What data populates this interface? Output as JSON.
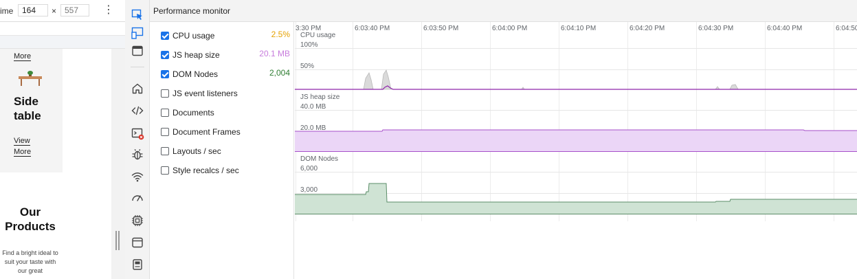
{
  "device_toolbar": {
    "label_partial": "ime",
    "width_value": "164",
    "times_sign": "×",
    "height_value": "557",
    "more_label": "⋮"
  },
  "page_preview": {
    "card_link_top": "More",
    "product_title": "Side table",
    "card_link_view": "View",
    "card_link_more": "More",
    "section_title": "Our Products",
    "section_desc": "Find a bright ideal to suit your taste with our great"
  },
  "panel": {
    "title": "Performance monitor"
  },
  "metrics": [
    {
      "label": "CPU usage",
      "checked": true,
      "value": "2.5%",
      "color": "#e5a100"
    },
    {
      "label": "JS heap size",
      "checked": true,
      "value": "20.1 MB",
      "color": "#c77cdc"
    },
    {
      "label": "DOM Nodes",
      "checked": true,
      "value": "2,004",
      "color": "#2e7d32"
    },
    {
      "label": "JS event listeners",
      "checked": false,
      "value": ""
    },
    {
      "label": "Documents",
      "checked": false,
      "value": ""
    },
    {
      "label": "Document Frames",
      "checked": false,
      "value": ""
    },
    {
      "label": "Layouts / sec",
      "checked": false,
      "value": ""
    },
    {
      "label": "Style recalcs / sec",
      "checked": false,
      "value": ""
    }
  ],
  "timeline": {
    "ticks": [
      "3:30 PM",
      "6:03:40 PM",
      "6:03:50 PM",
      "6:04:00 PM",
      "6:04:10 PM",
      "6:04:20 PM",
      "6:04:30 PM",
      "6:04:40 PM",
      "6:04:50"
    ]
  },
  "charts": {
    "cpu": {
      "name": "CPU usage",
      "gridlines": [
        "100%",
        "50%"
      ],
      "stroke": "#8e24aa",
      "fill": "#dadada"
    },
    "heap": {
      "name": "JS heap size",
      "gridlines": [
        "40.0 MB",
        "20.0 MB"
      ],
      "stroke": "#a64fc9",
      "fill": "#ebd6f7"
    },
    "dom": {
      "name": "DOM Nodes",
      "gridlines": [
        "6,000",
        "3,000"
      ],
      "stroke": "#5b8d68",
      "fill": "#cfe3d4"
    }
  },
  "icons": {
    "activity": [
      "inspect-icon",
      "device-toggle-icon",
      "window-icon",
      "home-icon",
      "code-icon",
      "console-icon",
      "bug-icon",
      "wifi-icon",
      "performance-icon",
      "memory-chip-icon",
      "application-icon",
      "storage-icon"
    ]
  }
}
